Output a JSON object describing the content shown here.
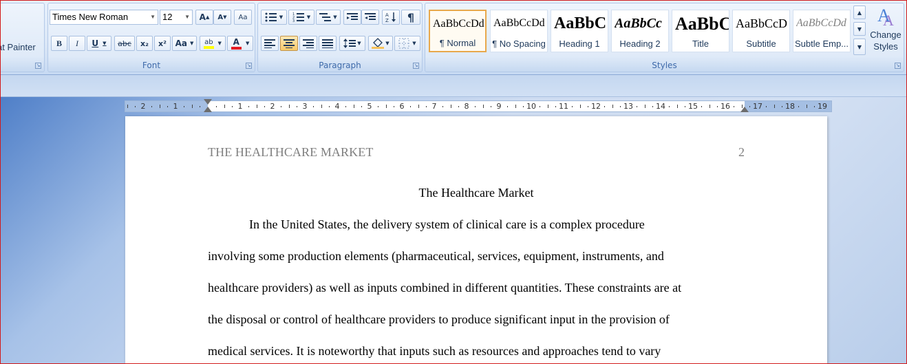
{
  "ribbon": {
    "clipboard": {
      "format_painter_label": "at Painter"
    },
    "font": {
      "group_label": "Font",
      "font_name": "Times New Roman",
      "font_size": "12",
      "grow_label": "A",
      "shrink_label": "A",
      "clear_label": "Aa",
      "bold_label": "B",
      "italic_label": "I",
      "underline_label": "U",
      "strike_label": "abc",
      "subscript_label": "x₂",
      "superscript_label": "x²",
      "case_label": "Aa",
      "highlight_label": "ab",
      "font_color_label": "A",
      "highlight_color": "#ffff00",
      "font_color": "#e51c23"
    },
    "paragraph": {
      "group_label": "Paragraph",
      "pilcrow_label": "¶"
    },
    "styles": {
      "group_label": "Styles",
      "change_styles_label": "Change Styles",
      "items": [
        {
          "sample": "AaBbCcDd",
          "name": "¶ Normal"
        },
        {
          "sample": "AaBbCcDd",
          "name": "¶ No Spacing"
        },
        {
          "sample": "AaBbC",
          "name": "Heading 1"
        },
        {
          "sample": "AaBbCc",
          "name": "Heading 2"
        },
        {
          "sample": "AaBbC",
          "name": "Title"
        },
        {
          "sample": "AaBbCcD",
          "name": "Subtitle"
        },
        {
          "sample": "AaBbCcDd",
          "name": "Subtle Emp..."
        }
      ]
    }
  },
  "ruler": {
    "labels": [
      "2",
      "1",
      "1",
      "2",
      "3",
      "4",
      "5",
      "6",
      "7",
      "8",
      "9",
      "10",
      "11",
      "12",
      "13",
      "14",
      "15",
      "16",
      "17",
      "18",
      "19"
    ]
  },
  "document": {
    "running_head": "THE HEALTHCARE MARKET",
    "page_number": "2",
    "title": "The Healthcare Market",
    "lines": [
      "In the United States, the delivery system of clinical care is a complex procedure",
      "involving some production elements (pharmaceutical, services, equipment, instruments, and",
      "healthcare providers) as well as inputs combined in different quantities. These constraints are at",
      "the disposal or control of healthcare providers to produce significant input in the provision of",
      "medical services. It is noteworthy that inputs such as resources and approaches tend to vary"
    ]
  }
}
